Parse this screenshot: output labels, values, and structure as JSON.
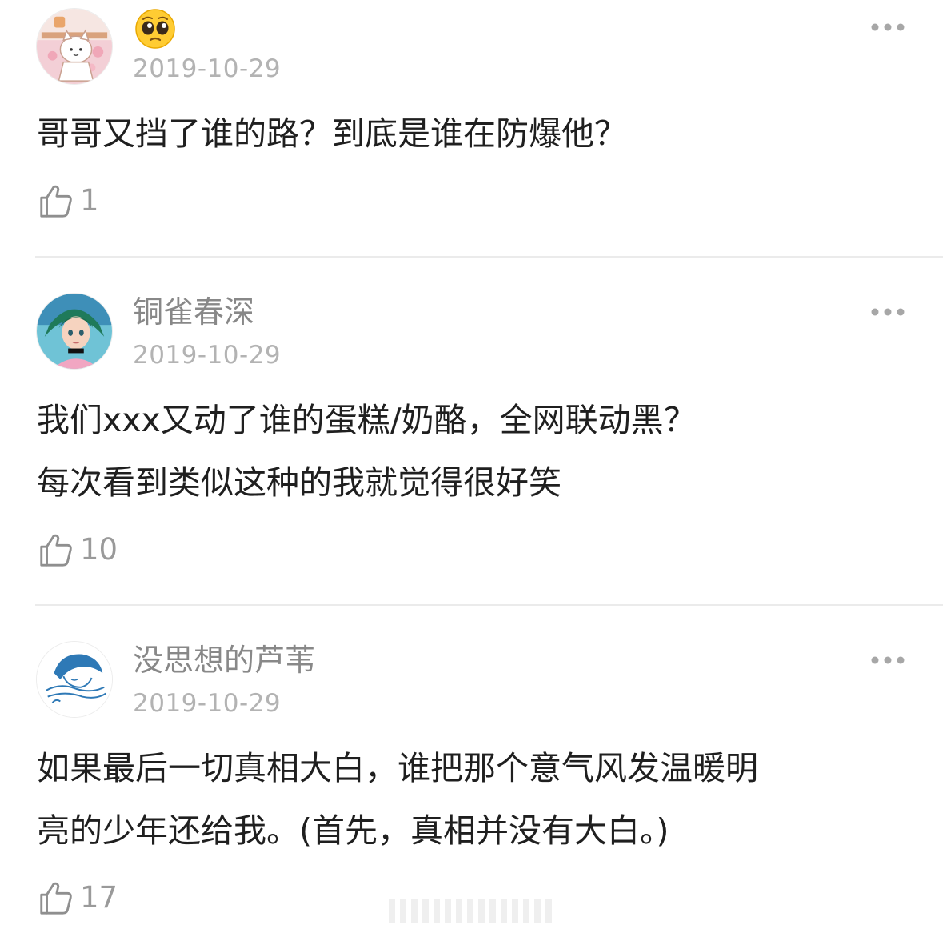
{
  "comments": [
    {
      "username": "🥺",
      "date": "2019-10-29",
      "text_lines": [
        "哥哥又挡了谁的路？到底是谁在防爆他？"
      ],
      "like_count": "1",
      "avatar_icon": "cat-illustration-avatar"
    },
    {
      "username": "铜雀春深",
      "date": "2019-10-29",
      "text_lines": [
        "我们xxx又动了谁的蛋糕/奶酪，全网联动黑？",
        "每次看到类似这种的我就觉得很好笑"
      ],
      "like_count": "10",
      "avatar_icon": "anime-girl-avatar"
    },
    {
      "username": "没思想的芦苇",
      "date": "2019-10-29",
      "text_lines": [
        "如果最后一切真相大白，谁把那个意气风发温暖明",
        "亮的少年还给我。(首先，真相并没有大白。)"
      ],
      "like_count": "17",
      "avatar_icon": "line-drawing-avatar"
    }
  ],
  "icons": {
    "like": "thumbs-up-icon",
    "more": "more-dots-icon"
  },
  "colors": {
    "text": "#1f1f1f",
    "username": "#888888",
    "date": "#b3b3b3",
    "like_count": "#9a9a9a",
    "divider": "#ebebeb"
  }
}
